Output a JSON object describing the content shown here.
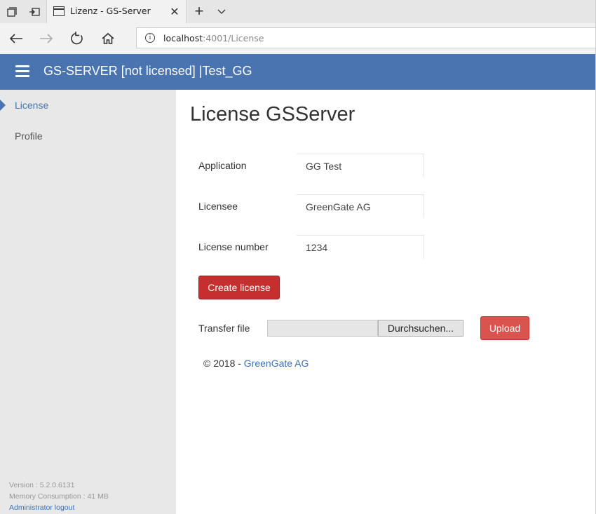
{
  "browser": {
    "tab_title": "Lizenz - GS-Server",
    "url_host": "localhost",
    "url_path": ":4001/License",
    "info_glyph": "i",
    "close_glyph": "✕",
    "newtab_glyph": "+"
  },
  "header": {
    "title": "GS-SERVER [not licensed] |Test_GG"
  },
  "sidebar": {
    "items": [
      {
        "label": "License",
        "active": true
      },
      {
        "label": "Profile",
        "active": false
      }
    ],
    "version": "Version : 5.2.0.6131",
    "memory": "Memory Consumption : 41 MB",
    "logout": "Administrator logout"
  },
  "main": {
    "title": "License GSServer",
    "fields": [
      {
        "label": "Application",
        "value": "GG Test"
      },
      {
        "label": "Licensee",
        "value": "GreenGate AG"
      },
      {
        "label": "License number",
        "value": "1234"
      }
    ],
    "create_label": "Create license",
    "transfer_label": "Transfer file",
    "browse_label": "Durchsuchen...",
    "upload_label": "Upload"
  },
  "footer": {
    "copyright": "© 2018 - ",
    "company": "GreenGate AG"
  },
  "colors": {
    "header": "#4a74b0",
    "create_button": "#c62f2f",
    "upload_button": "#d9534f",
    "link": "#3b73b5"
  }
}
